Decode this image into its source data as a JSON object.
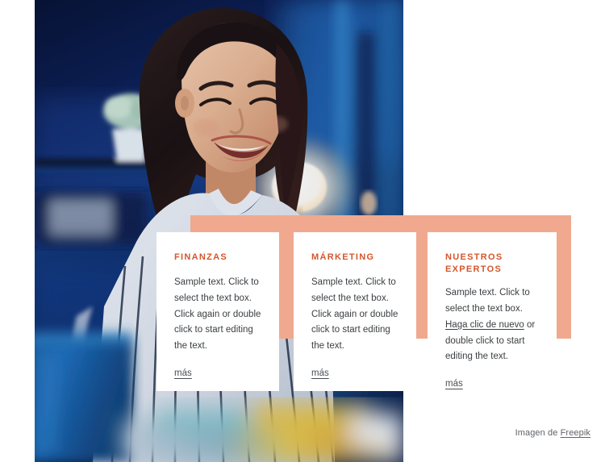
{
  "colors": {
    "accent_band": "#f0a98f",
    "heading": "#d4562c",
    "body_text": "#3c4043",
    "card_background": "#ffffff",
    "page_background": "#ffffff",
    "photo_backdrop": "#0a1840"
  },
  "photo": {
    "alt": "Smiling young woman in a striped shirt at a desk with blue ambient lighting",
    "elements": [
      "smiling-woman",
      "striped-shirt",
      "potted-plant",
      "round-glowing-lamp",
      "blue-mug",
      "desk-books"
    ]
  },
  "cards": [
    {
      "title": "FINANZAS",
      "body": "Sample text. Click to select the text box. Click again or double click to start editing the text.",
      "more_label": "más"
    },
    {
      "title": "MÁRKETING",
      "body": "Sample text. Click to select the text box. Click again or double click to start editing the text.",
      "more_label": "más"
    },
    {
      "title": "NUESTROS EXPERTOS",
      "body_before": "Sample text. Click to select the text box. ",
      "inline_link": "Haga clic de nuevo",
      "body_after": " or double click to start editing the text.",
      "more_label": "más"
    }
  ],
  "attribution": {
    "prefix": "Imagen de ",
    "link_label": "Freepik"
  }
}
